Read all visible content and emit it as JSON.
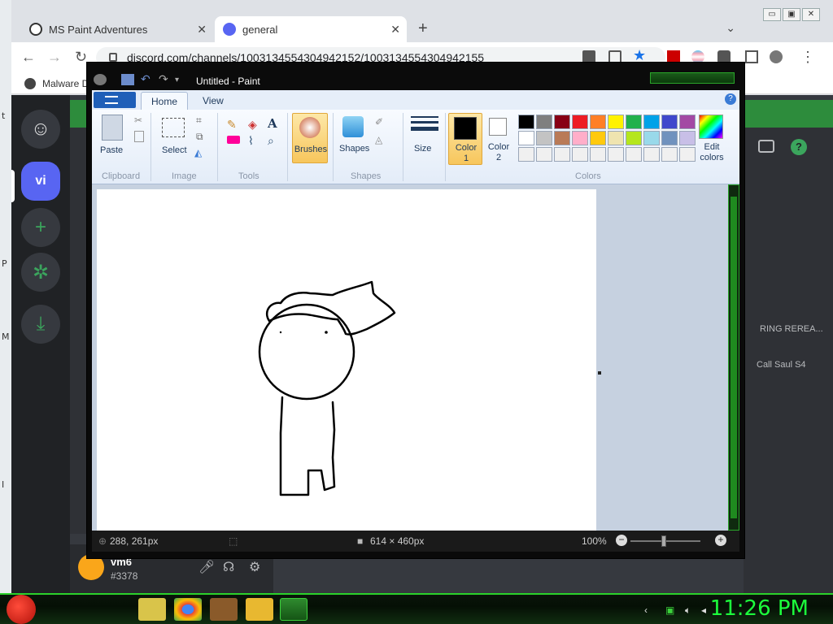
{
  "chrome": {
    "tabs": [
      {
        "label": "MS Paint Adventures",
        "active": false
      },
      {
        "label": "general",
        "active": true
      }
    ],
    "url": "discord.com/channels/1003134554304942152/1003134554304942155",
    "bookmark": "Malware D",
    "win_buttons": [
      "▭",
      "▣",
      "✕"
    ]
  },
  "discord": {
    "guilds": [
      "vi"
    ],
    "right_text": [
      "RING REREA...",
      "Call Saul S4"
    ],
    "user": {
      "name": "vm6",
      "tag": "#3378"
    }
  },
  "paint": {
    "title": "Untitled - Paint",
    "tabs": [
      "Home",
      "View"
    ],
    "clipboard": {
      "paste": "Paste",
      "label": "Clipboard"
    },
    "image": {
      "select": "Select",
      "label": "Image"
    },
    "tools": {
      "label": "Tools"
    },
    "brushes": "Brushes",
    "shapes": {
      "shapes": "Shapes",
      "label": "Shapes"
    },
    "size": "Size",
    "color1": {
      "line1": "Color",
      "line2": "1"
    },
    "color2": {
      "line1": "Color",
      "line2": "2"
    },
    "colors_label": "Colors",
    "edit_colors": {
      "line1": "Edit",
      "line2": "colors"
    },
    "palette": [
      "#000000",
      "#7f7f7f",
      "#880015",
      "#ed1c24",
      "#ff7f27",
      "#fff200",
      "#22b14c",
      "#00a2e8",
      "#3f48cc",
      "#a349a4",
      "#ffffff",
      "#c3c3c3",
      "#b97a57",
      "#ffaec9",
      "#ffc90e",
      "#efe4b0",
      "#b5e61d",
      "#99d9ea",
      "#7092be",
      "#c8bfe7",
      "#f0f0f0",
      "#f0f0f0",
      "#f0f0f0",
      "#f0f0f0",
      "#f0f0f0",
      "#f0f0f0",
      "#f0f0f0",
      "#f0f0f0",
      "#f0f0f0",
      "#f0f0f0"
    ],
    "status": {
      "cursor": "288, 261px",
      "size": "614 × 460px",
      "zoom": "100%"
    }
  },
  "taskbar": {
    "clock": "11:26 PM"
  }
}
